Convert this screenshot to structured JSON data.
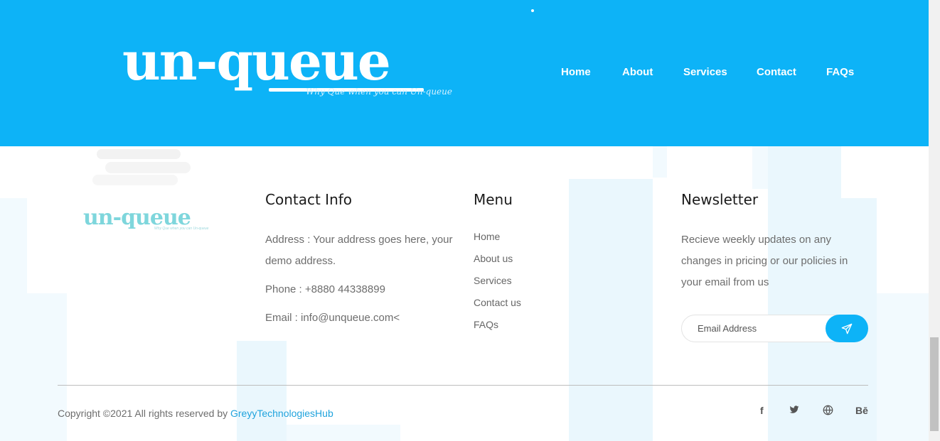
{
  "header": {
    "logo_text": "un-queue",
    "logo_tagline": "Why Que when you can Un-queue",
    "nav": [
      "Home",
      "About",
      "Services",
      "Contact",
      "FAQs"
    ]
  },
  "footer": {
    "logo_text": "un-queue",
    "logo_tagline": "Why Que when you can Un-queue",
    "contact": {
      "title": "Contact Info",
      "address": "Address : Your address goes here, your demo address.",
      "phone": "Phone : +8880 44338899",
      "email": "Email : info@unqueue.com<"
    },
    "menu": {
      "title": "Menu",
      "items": [
        "Home",
        "About us",
        "Services",
        "Contact us",
        "FAQs"
      ]
    },
    "newsletter": {
      "title": "Newsletter",
      "text": "Recieve weekly updates on any changes in pricing or our policies in your email from us",
      "placeholder": "Email Address",
      "send_icon": "paper-plane-icon"
    },
    "copyright": "Copyright ©2021 All rights reserved by",
    "copyright_brand": "GreyyTechnologiesHub",
    "social": {
      "facebook": "f",
      "twitter": "twitter-icon",
      "website": "globe-icon",
      "behance": "Bē"
    }
  },
  "colors": {
    "header_bg": "#0db3f7",
    "accent": "#0db3f7",
    "link": "#1fa3dd"
  }
}
